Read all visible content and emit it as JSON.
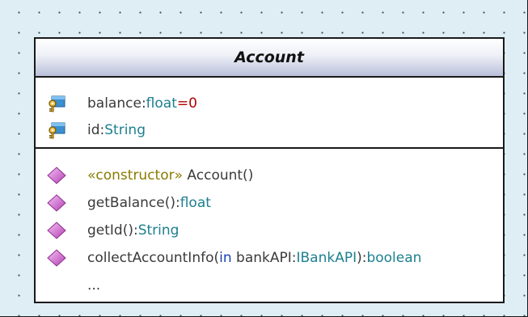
{
  "class": {
    "name": "Account",
    "attributes": [
      {
        "name": "balance",
        "sep": ":",
        "type": "float",
        "assign": "=",
        "default": "0",
        "icon": "private-attribute-key-icon"
      },
      {
        "name": "id",
        "sep": ":",
        "type": "String",
        "icon": "private-attribute-key-icon"
      }
    ],
    "operations": [
      {
        "stereotype": "«constructor»",
        "name": " Account()",
        "icon": "operation-diamond-icon"
      },
      {
        "name": "getBalance():",
        "type": "float",
        "icon": "operation-diamond-icon"
      },
      {
        "name": "getId():",
        "type": "String",
        "icon": "operation-diamond-icon"
      },
      {
        "name": "collectAccountInfo(",
        "direction": "in",
        "param": " bankAPI:",
        "param_type": "IBankAPI",
        "close": "):",
        "type": "boolean",
        "icon": "operation-diamond-icon"
      }
    ],
    "more": "..."
  },
  "colors": {
    "background": "#dfeef5",
    "header_gradient_end": "#b9bfd9",
    "type_color": "#1d7f8f",
    "default_value_color": "#b00000",
    "stereotype_color": "#8a7a00",
    "direction_color": "#1a3fb8",
    "diamond_color": "#d86ad8"
  }
}
